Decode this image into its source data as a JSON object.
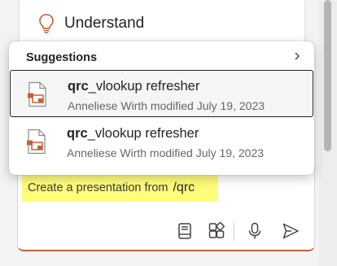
{
  "understand_card": {
    "label": "Understand",
    "icon": "lightbulb-icon"
  },
  "suggestions": {
    "header": "Suggestions",
    "items": [
      {
        "title_match": "qrc",
        "title_rest": "_vlookup refresher",
        "meta": "Anneliese Wirth modified July 19, 2023",
        "icon": "presentation-file-icon",
        "selected": true
      },
      {
        "title_match": "qrc",
        "title_rest": "_vlookup refresher",
        "meta": "Anneliese Wirth modified July 19, 2023",
        "icon": "presentation-file-icon",
        "selected": false
      }
    ]
  },
  "compose": {
    "prompt_text": "Create a presentation from",
    "prompt_command": "/qrc",
    "icons": [
      "notebook-icon",
      "add-apps-icon",
      "microphone-icon",
      "send-icon"
    ]
  },
  "colors": {
    "accent": "#c5613a",
    "highlight": "#fffd7a"
  }
}
